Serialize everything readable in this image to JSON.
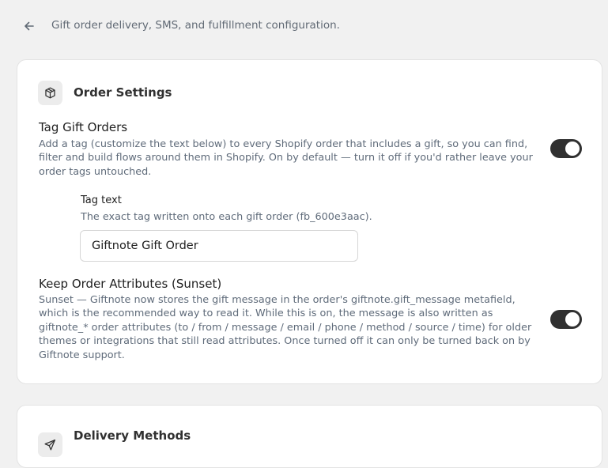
{
  "header": {
    "subtitle": "Gift order delivery, SMS, and fulfillment configuration."
  },
  "order_settings": {
    "title": "Order Settings",
    "icon": "package-icon",
    "tag_gift_orders": {
      "title": "Tag Gift Orders",
      "description": "Add a tag (customize the text below) to every Shopify order that includes a gift, so you can find, filter and build flows around them in Shopify. On by default — turn it off if you'd rather leave your order tags untouched.",
      "enabled": true,
      "tag_text": {
        "label": "Tag text",
        "help": "The exact tag written onto each gift order (fb_600e3aac).",
        "value": "Giftnote Gift Order"
      }
    },
    "keep_order_attributes": {
      "title": "Keep Order Attributes (Sunset)",
      "description": "Sunset — Giftnote now stores the gift message in the order's giftnote.gift_message metafield, which is the recommended way to read it. While this is on, the message is also written as giftnote_* order attributes (to / from / message / email / phone / method / source / time) for older themes or integrations that still read attributes. Once turned off it can only be turned back on by Giftnote support.",
      "enabled": true
    }
  },
  "delivery_methods": {
    "title": "Delivery Methods",
    "icon": "send-icon"
  },
  "colors": {
    "page_background": "#f1f1f1",
    "card_background": "#ffffff",
    "toggle_on": "#303030",
    "muted_text": "#5f6b7a"
  }
}
